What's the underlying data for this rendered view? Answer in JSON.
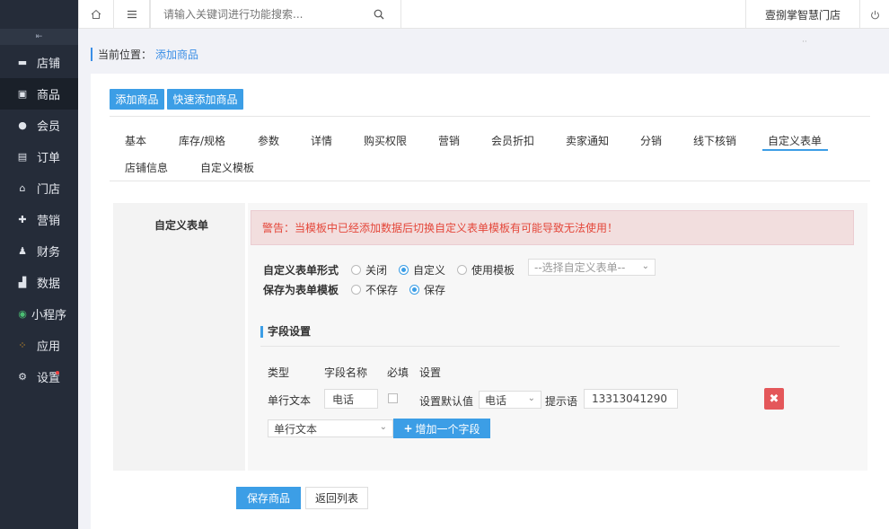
{
  "sidebar": {
    "collapse_icon": "collapse-icon",
    "items": [
      {
        "label": "店铺",
        "icon": "store-icon"
      },
      {
        "label": "商品",
        "icon": "goods-icon"
      },
      {
        "label": "会员",
        "icon": "member-icon"
      },
      {
        "label": "订单",
        "icon": "order-icon"
      },
      {
        "label": "门店",
        "icon": "shop-icon"
      },
      {
        "label": "营销",
        "icon": "gift-icon"
      },
      {
        "label": "财务",
        "icon": "money-icon"
      },
      {
        "label": "数据",
        "icon": "chart-icon"
      },
      {
        "label": "小程序",
        "icon": "miniapp-icon"
      },
      {
        "label": "应用",
        "icon": "apps-icon"
      },
      {
        "label": "设置",
        "icon": "gear-icon"
      }
    ]
  },
  "topbar": {
    "search_placeholder": "请输入关键词进行功能搜索...",
    "store_name": "壹捌掌智慧门店"
  },
  "breadcrumb": {
    "label": "当前位置：",
    "current": "添加商品"
  },
  "actions": {
    "add_goods": "添加商品",
    "quick_add_goods": "快速添加商品"
  },
  "tabs": [
    "基本",
    "库存/规格",
    "参数",
    "详情",
    "购买权限",
    "营销",
    "会员折扣",
    "卖家通知",
    "分销",
    "线下核销",
    "自定义表单",
    "店铺信息",
    "自定义模板"
  ],
  "active_tab": "自定义表单",
  "custom_form": {
    "section_label": "自定义表单",
    "warning": "警告：当模板中已经添加数据后切换自定义表单模板有可能导致无法使用！",
    "form_type": {
      "label": "自定义表单形式",
      "options": [
        "关闭",
        "自定义",
        "使用模板"
      ],
      "selected": "自定义",
      "template_select_placeholder": "--选择自定义表单--"
    },
    "save_as_template": {
      "label": "保存为表单模板",
      "options": [
        "不保存",
        "保存"
      ],
      "selected": "保存"
    },
    "field_settings": {
      "title": "字段设置",
      "headers": [
        "类型",
        "字段名称",
        "必填",
        "设置"
      ],
      "rows": [
        {
          "type": "单行文本",
          "name": "电话",
          "required": false,
          "default_label": "设置默认值",
          "default_value": "电话",
          "hint_label": "提示语",
          "hint_value": "13313041290"
        }
      ],
      "new_field_type": "单行文本",
      "add_field_label": "增加一个字段"
    }
  },
  "footer": {
    "save": "保存商品",
    "back": "返回列表"
  }
}
